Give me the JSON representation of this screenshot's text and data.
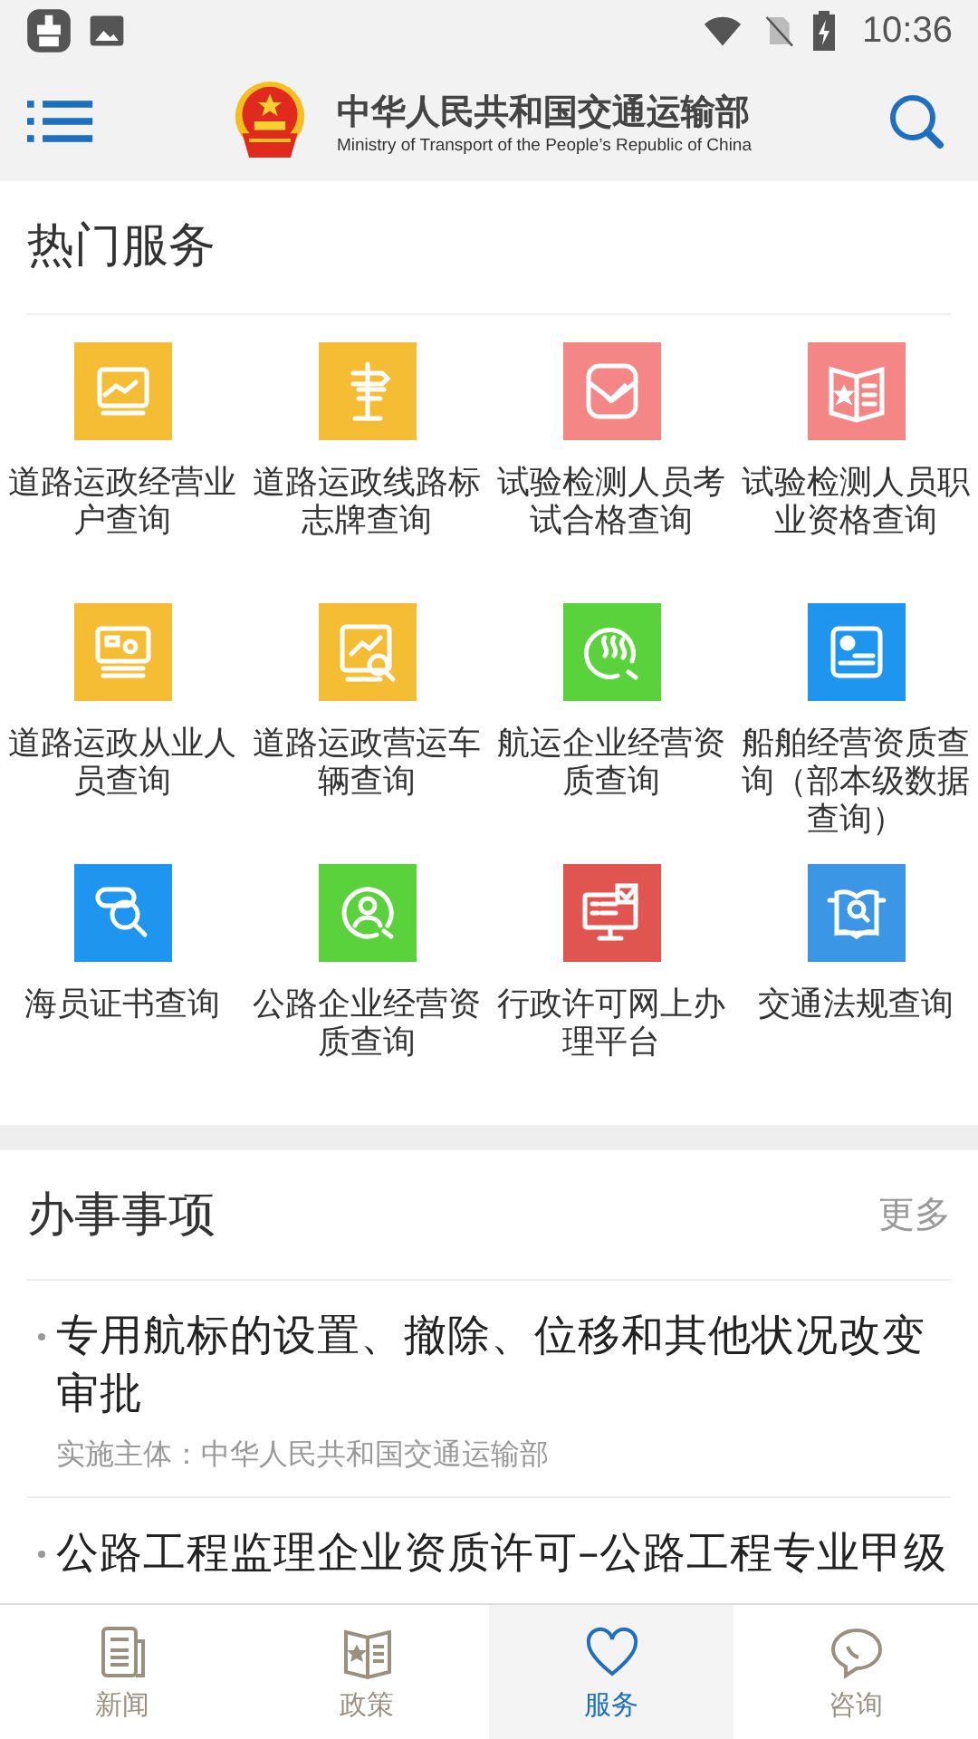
{
  "status_bar": {
    "time": "10:36"
  },
  "header": {
    "title": "中华人民共和国交通运输部",
    "subtitle": "Ministry of Transport of the People’s Republic of China"
  },
  "hot_services": {
    "title": "热门服务",
    "items": [
      {
        "label": "道路运政经营业户查询",
        "color": "#f4bd33"
      },
      {
        "label": "道路运政线路标志牌查询",
        "color": "#f4bd33"
      },
      {
        "label": "试验检测人员考试合格查询",
        "color": "#f48686"
      },
      {
        "label": "试验检测人员职业资格查询",
        "color": "#f48686"
      },
      {
        "label": "道路运政从业人员查询",
        "color": "#f4bd33"
      },
      {
        "label": "道路运政营运车辆查询",
        "color": "#f4bd33"
      },
      {
        "label": "航运企业经营资质查询",
        "color": "#5ad23c"
      },
      {
        "label": "船舶经营资质查询（部本级数据查询）",
        "color": "#1e96f0"
      },
      {
        "label": "海员证书查询",
        "color": "#1e96f0"
      },
      {
        "label": "公路企业经营资质查询",
        "color": "#5ad23c"
      },
      {
        "label": "行政许可网上办理平台",
        "color": "#e05550"
      },
      {
        "label": "交通法规查询",
        "color": "#3c96e6"
      }
    ]
  },
  "affairs": {
    "title": "办事事项",
    "more": "更多",
    "items": [
      {
        "title": "专用航标的设置、撤除、位移和其他状况改变审批",
        "subject": "实施主体：中华人民共和国交通运输部"
      },
      {
        "title": "公路工程监理企业资质许可–公路工程专业甲级"
      }
    ]
  },
  "bottom_nav": [
    {
      "label": "新闻",
      "selected": false
    },
    {
      "label": "政策",
      "selected": false
    },
    {
      "label": "服务",
      "selected": true
    },
    {
      "label": "咨询",
      "selected": false
    }
  ]
}
